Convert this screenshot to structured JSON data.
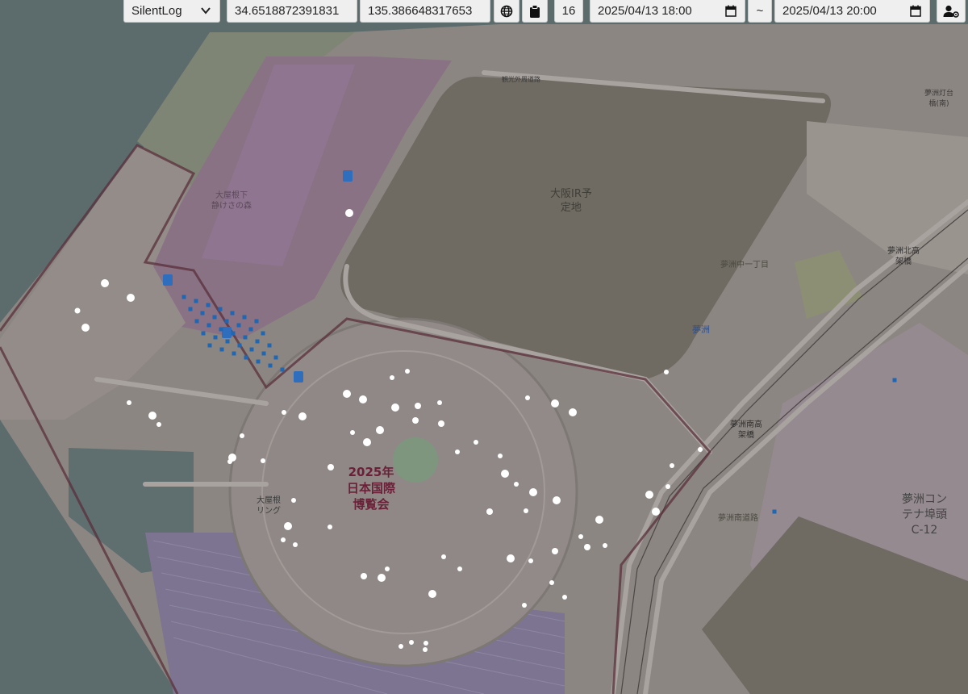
{
  "toolbar": {
    "mode_select": {
      "value": "SilentLog",
      "icon": "chevron-down-icon"
    },
    "latitude": "34.6518872391831",
    "longitude": "135.386648317653",
    "globe_icon": "globe-icon",
    "clipboard_icon": "clipboard-icon",
    "zoom": "16",
    "start_datetime": "2025/04/13 18:00",
    "separator": "~",
    "end_datetime": "2025/04/13 20:00",
    "calendar_icon": "calendar-icon",
    "user_settings_icon": "user-gear-icon"
  },
  "map": {
    "labels": {
      "osaka_ir": "大阪IR予\n定地",
      "expo": "2025年\n日本国際\n博覧会",
      "yumeshima_container": "夢洲コン\nテナ埠頭\nC-12",
      "yumeshima_1chome": "夢洲中一丁目",
      "yumeshima_station": "夢洲",
      "yumeshima_minami_bridge": "夢洲南高\n架橋",
      "yumeshima_kita_bridge": "夢洲北高\n架橋",
      "yumeshima_south_road": "夢洲南道路",
      "big_roof_ring": "大屋根\nリング",
      "forest_of_calm": "大屋根下\n静けさの森",
      "kanko_road": "観光外周道路",
      "tower_label": "夢洲灯台\n橋(南)"
    },
    "colors": {
      "water": "#5c6b6b",
      "land": "#8e8884",
      "pink_zone": "#8a6f86",
      "ir_site": "#6f6a62",
      "boundary": "#5a2f3b",
      "dot_white": "#ffffff",
      "dot_blue": "#1f66b3"
    }
  }
}
